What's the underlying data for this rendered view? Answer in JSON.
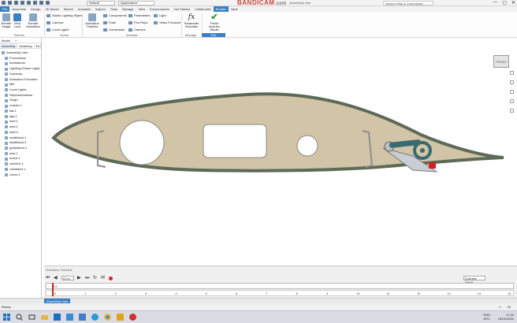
{
  "titlebar": {
    "style_dropdown": "Default",
    "appearance_dropdown": "Appearance",
    "recorder_brand": "BANDICAM",
    "recorder_url": ".com",
    "file_title": "Assembly1.iam",
    "search_placeholder": "Search Help & Commands...",
    "window_controls": [
      "—",
      "▢",
      "✕"
    ]
  },
  "ribbon_tabs": [
    "File",
    "Assemble",
    "Design",
    "3D Model",
    "Sketch",
    "Annotate",
    "Inspect",
    "Tools",
    "Manage",
    "View",
    "Environments",
    "Get Started",
    "Collaborate",
    "Render",
    "Vault"
  ],
  "active_tab": "Render",
  "ribbon": {
    "render_image": "Render Image",
    "view_lock": "View Lock",
    "render_animation": "Render Animation",
    "studio_lighting_styles": "Studio Lighting Styles",
    "camera": "Camera",
    "local_lights": "Local Lights",
    "animation_timeline": "Animation Timeline",
    "components": "Components",
    "fade": "Fade",
    "constraints": "Constraints",
    "parameters": "Parameters",
    "pos_reps": "Pos Reps",
    "camera2": "Camera",
    "light": "Light",
    "video_producer": "Video Producer",
    "parameter_favorites": "Parameter Favorites",
    "finish_studio": "Finish Inventor Studio",
    "group_render": "Render",
    "group_scene": "Scene",
    "group_animate": "Animate",
    "group_manage": "Manage",
    "group_exit": "Exit"
  },
  "browser": {
    "header": [
      "Model",
      "+"
    ],
    "tabs": [
      "Assembly",
      "Modeling",
      "Environment"
    ],
    "items": [
      "Assembly1.iam",
      "Productions",
      "Animations",
      "Lighting (Grace Light)",
      "Cameras",
      "Animation Favorites",
      "Mill",
      "Local Lights",
      "Representations",
      "Origin",
      "nosher:1",
      "flat:1",
      "flap:1",
      "axel:1",
      "axel:2",
      "axel:4",
      "shaftblock:1",
      "shaftblock:2",
      "guideblock:1",
      "axis:1",
      "motor:1",
      "crank1h:1",
      "rotmblbar:1",
      "rotmn:1"
    ]
  },
  "viewcube_label": "FRONT",
  "timeline": {
    "title": "Animation Timeline",
    "time_value": "0.0 s",
    "view_value": "[Current View]",
    "track_time": "0.0",
    "ticks": [
      "0",
      "1",
      "2",
      "3",
      "4",
      "5",
      "6",
      "7",
      "8",
      "9",
      "10",
      "11",
      "12",
      "13",
      "14",
      "15"
    ]
  },
  "doc_tab": "Assembly1.iam",
  "status": {
    "left": "Ready",
    "right": [
      "1",
      "15"
    ]
  },
  "taskbar": {
    "lang": [
      "ENG",
      "INTL"
    ],
    "time": "17:34",
    "date": "24/02/2021"
  },
  "colors": {
    "accent": "#3b7fc4",
    "wing_fill": "#d2c4a6",
    "wing_outline": "#5c6a57",
    "strut_teal": "#3a6a72",
    "record_red": "#d22222"
  }
}
